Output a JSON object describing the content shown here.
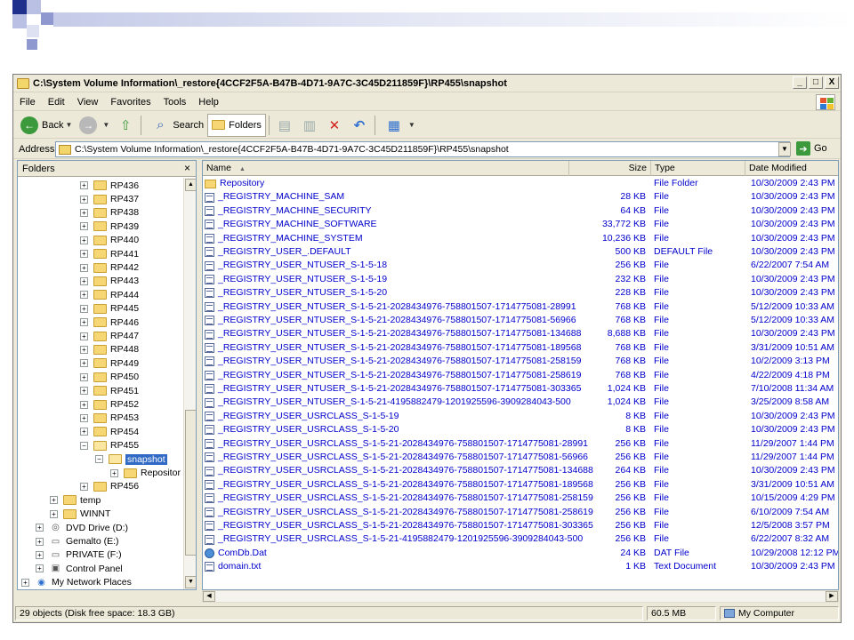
{
  "window": {
    "title": "C:\\System Volume Information\\_restore{4CCF2F5A-B47B-4D71-9A7C-3C45D211859F}\\RP455\\snapshot",
    "controls": {
      "minimize": "_",
      "maximize": "□",
      "close": "X"
    }
  },
  "menu": [
    "File",
    "Edit",
    "View",
    "Favorites",
    "Tools",
    "Help"
  ],
  "toolbar": {
    "back": "Back",
    "search": "Search",
    "folders": "Folders"
  },
  "address": {
    "label": "Address",
    "value": "C:\\System Volume Information\\_restore{4CCF2F5A-B47B-4D71-9A7C-3C45D211859F}\\RP455\\snapshot",
    "go": "Go"
  },
  "folders_pane": {
    "title": "Folders",
    "close": "×",
    "items": [
      {
        "label": "RP436",
        "level": 2,
        "pm": "+"
      },
      {
        "label": "RP437",
        "level": 2,
        "pm": "+"
      },
      {
        "label": "RP438",
        "level": 2,
        "pm": "+"
      },
      {
        "label": "RP439",
        "level": 2,
        "pm": "+"
      },
      {
        "label": "RP440",
        "level": 2,
        "pm": "+"
      },
      {
        "label": "RP441",
        "level": 2,
        "pm": "+"
      },
      {
        "label": "RP442",
        "level": 2,
        "pm": "+"
      },
      {
        "label": "RP443",
        "level": 2,
        "pm": "+"
      },
      {
        "label": "RP444",
        "level": 2,
        "pm": "+"
      },
      {
        "label": "RP445",
        "level": 2,
        "pm": "+"
      },
      {
        "label": "RP446",
        "level": 2,
        "pm": "+"
      },
      {
        "label": "RP447",
        "level": 2,
        "pm": "+"
      },
      {
        "label": "RP448",
        "level": 2,
        "pm": "+"
      },
      {
        "label": "RP449",
        "level": 2,
        "pm": "+"
      },
      {
        "label": "RP450",
        "level": 2,
        "pm": "+"
      },
      {
        "label": "RP451",
        "level": 2,
        "pm": "+"
      },
      {
        "label": "RP452",
        "level": 2,
        "pm": "+"
      },
      {
        "label": "RP453",
        "level": 2,
        "pm": "+"
      },
      {
        "label": "RP454",
        "level": 2,
        "pm": "+"
      },
      {
        "label": "RP455",
        "level": 2,
        "pm": "−"
      },
      {
        "label": "snapshot",
        "level": 3,
        "pm": "−",
        "selected": true
      },
      {
        "label": "Repositor",
        "level": 4,
        "pm": "+"
      },
      {
        "label": "RP456",
        "level": 2,
        "pm": "+"
      },
      {
        "label": "temp",
        "level": 1,
        "pm": "+"
      },
      {
        "label": "WINNT",
        "level": 1,
        "pm": "+"
      },
      {
        "label": "DVD Drive (D:)",
        "level": 0,
        "pm": "+",
        "icon": "dvd-icon"
      },
      {
        "label": "Gemalto (E:)",
        "level": 0,
        "pm": "+",
        "icon": "drive-icon"
      },
      {
        "label": "PRIVATE (F:)",
        "level": 0,
        "pm": "+",
        "icon": "drive-icon"
      },
      {
        "label": "Control Panel",
        "level": 0,
        "pm": "+",
        "icon": "control-panel-icon"
      },
      {
        "label": "My Network Places",
        "level": -1,
        "pm": "+",
        "icon": "network-icon"
      }
    ]
  },
  "list": {
    "columns": {
      "name": "Name",
      "size": "Size",
      "type": "Type",
      "date": "Date Modified"
    },
    "rows": [
      {
        "name": "Repository",
        "size": "",
        "type": "File Folder",
        "date": "10/30/2009 2:43 PM",
        "icon": "folder"
      },
      {
        "name": "_REGISTRY_MACHINE_SAM",
        "size": "28 KB",
        "type": "File",
        "date": "10/30/2009 2:43 PM",
        "icon": "file"
      },
      {
        "name": "_REGISTRY_MACHINE_SECURITY",
        "size": "64 KB",
        "type": "File",
        "date": "10/30/2009 2:43 PM",
        "icon": "file"
      },
      {
        "name": "_REGISTRY_MACHINE_SOFTWARE",
        "size": "33,772 KB",
        "type": "File",
        "date": "10/30/2009 2:43 PM",
        "icon": "file"
      },
      {
        "name": "_REGISTRY_MACHINE_SYSTEM",
        "size": "10,236 KB",
        "type": "File",
        "date": "10/30/2009 2:43 PM",
        "icon": "file"
      },
      {
        "name": "_REGISTRY_USER_.DEFAULT",
        "size": "500 KB",
        "type": "DEFAULT File",
        "date": "10/30/2009 2:43 PM",
        "icon": "file"
      },
      {
        "name": "_REGISTRY_USER_NTUSER_S-1-5-18",
        "size": "256 KB",
        "type": "File",
        "date": "6/22/2007 7:54 AM",
        "icon": "file"
      },
      {
        "name": "_REGISTRY_USER_NTUSER_S-1-5-19",
        "size": "232 KB",
        "type": "File",
        "date": "10/30/2009 2:43 PM",
        "icon": "file"
      },
      {
        "name": "_REGISTRY_USER_NTUSER_S-1-5-20",
        "size": "228 KB",
        "type": "File",
        "date": "10/30/2009 2:43 PM",
        "icon": "file"
      },
      {
        "name": "_REGISTRY_USER_NTUSER_S-1-5-21-2028434976-758801507-1714775081-28991",
        "size": "768 KB",
        "type": "File",
        "date": "5/12/2009 10:33 AM",
        "icon": "file"
      },
      {
        "name": "_REGISTRY_USER_NTUSER_S-1-5-21-2028434976-758801507-1714775081-56966",
        "size": "768 KB",
        "type": "File",
        "date": "5/12/2009 10:33 AM",
        "icon": "file"
      },
      {
        "name": "_REGISTRY_USER_NTUSER_S-1-5-21-2028434976-758801507-1714775081-134688",
        "size": "8,688 KB",
        "type": "File",
        "date": "10/30/2009 2:43 PM",
        "icon": "file"
      },
      {
        "name": "_REGISTRY_USER_NTUSER_S-1-5-21-2028434976-758801507-1714775081-189568",
        "size": "768 KB",
        "type": "File",
        "date": "3/31/2009 10:51 AM",
        "icon": "file"
      },
      {
        "name": "_REGISTRY_USER_NTUSER_S-1-5-21-2028434976-758801507-1714775081-258159",
        "size": "768 KB",
        "type": "File",
        "date": "10/2/2009 3:13 PM",
        "icon": "file"
      },
      {
        "name": "_REGISTRY_USER_NTUSER_S-1-5-21-2028434976-758801507-1714775081-258619",
        "size": "768 KB",
        "type": "File",
        "date": "4/22/2009 4:18 PM",
        "icon": "file"
      },
      {
        "name": "_REGISTRY_USER_NTUSER_S-1-5-21-2028434976-758801507-1714775081-303365",
        "size": "1,024 KB",
        "type": "File",
        "date": "7/10/2008 11:34 AM",
        "icon": "file"
      },
      {
        "name": "_REGISTRY_USER_NTUSER_S-1-5-21-4195882479-1201925596-3909284043-500",
        "size": "1,024 KB",
        "type": "File",
        "date": "3/25/2009 8:58 AM",
        "icon": "file"
      },
      {
        "name": "_REGISTRY_USER_USRCLASS_S-1-5-19",
        "size": "8 KB",
        "type": "File",
        "date": "10/30/2009 2:43 PM",
        "icon": "file"
      },
      {
        "name": "_REGISTRY_USER_USRCLASS_S-1-5-20",
        "size": "8 KB",
        "type": "File",
        "date": "10/30/2009 2:43 PM",
        "icon": "file"
      },
      {
        "name": "_REGISTRY_USER_USRCLASS_S-1-5-21-2028434976-758801507-1714775081-28991",
        "size": "256 KB",
        "type": "File",
        "date": "11/29/2007 1:44 PM",
        "icon": "file"
      },
      {
        "name": "_REGISTRY_USER_USRCLASS_S-1-5-21-2028434976-758801507-1714775081-56966",
        "size": "256 KB",
        "type": "File",
        "date": "11/29/2007 1:44 PM",
        "icon": "file"
      },
      {
        "name": "_REGISTRY_USER_USRCLASS_S-1-5-21-2028434976-758801507-1714775081-134688",
        "size": "264 KB",
        "type": "File",
        "date": "10/30/2009 2:43 PM",
        "icon": "file"
      },
      {
        "name": "_REGISTRY_USER_USRCLASS_S-1-5-21-2028434976-758801507-1714775081-189568",
        "size": "256 KB",
        "type": "File",
        "date": "3/31/2009 10:51 AM",
        "icon": "file"
      },
      {
        "name": "_REGISTRY_USER_USRCLASS_S-1-5-21-2028434976-758801507-1714775081-258159",
        "size": "256 KB",
        "type": "File",
        "date": "10/15/2009 4:29 PM",
        "icon": "file"
      },
      {
        "name": "_REGISTRY_USER_USRCLASS_S-1-5-21-2028434976-758801507-1714775081-258619",
        "size": "256 KB",
        "type": "File",
        "date": "6/10/2009 7:54 AM",
        "icon": "file"
      },
      {
        "name": "_REGISTRY_USER_USRCLASS_S-1-5-21-2028434976-758801507-1714775081-303365",
        "size": "256 KB",
        "type": "File",
        "date": "12/5/2008 3:57 PM",
        "icon": "file"
      },
      {
        "name": "_REGISTRY_USER_USRCLASS_S-1-5-21-4195882479-1201925596-3909284043-500",
        "size": "256 KB",
        "type": "File",
        "date": "6/22/2007 8:32 AM",
        "icon": "file"
      },
      {
        "name": "ComDb.Dat",
        "size": "24 KB",
        "type": "DAT File",
        "date": "10/29/2008 12:12 PM",
        "icon": "dat"
      },
      {
        "name": "domain.txt",
        "size": "1 KB",
        "type": "Text Document",
        "date": "10/30/2009 2:43 PM",
        "icon": "file"
      }
    ]
  },
  "status": {
    "objects": "29 objects (Disk free space: 18.3 GB)",
    "size": "60.5 MB",
    "zone": "My Computer"
  }
}
